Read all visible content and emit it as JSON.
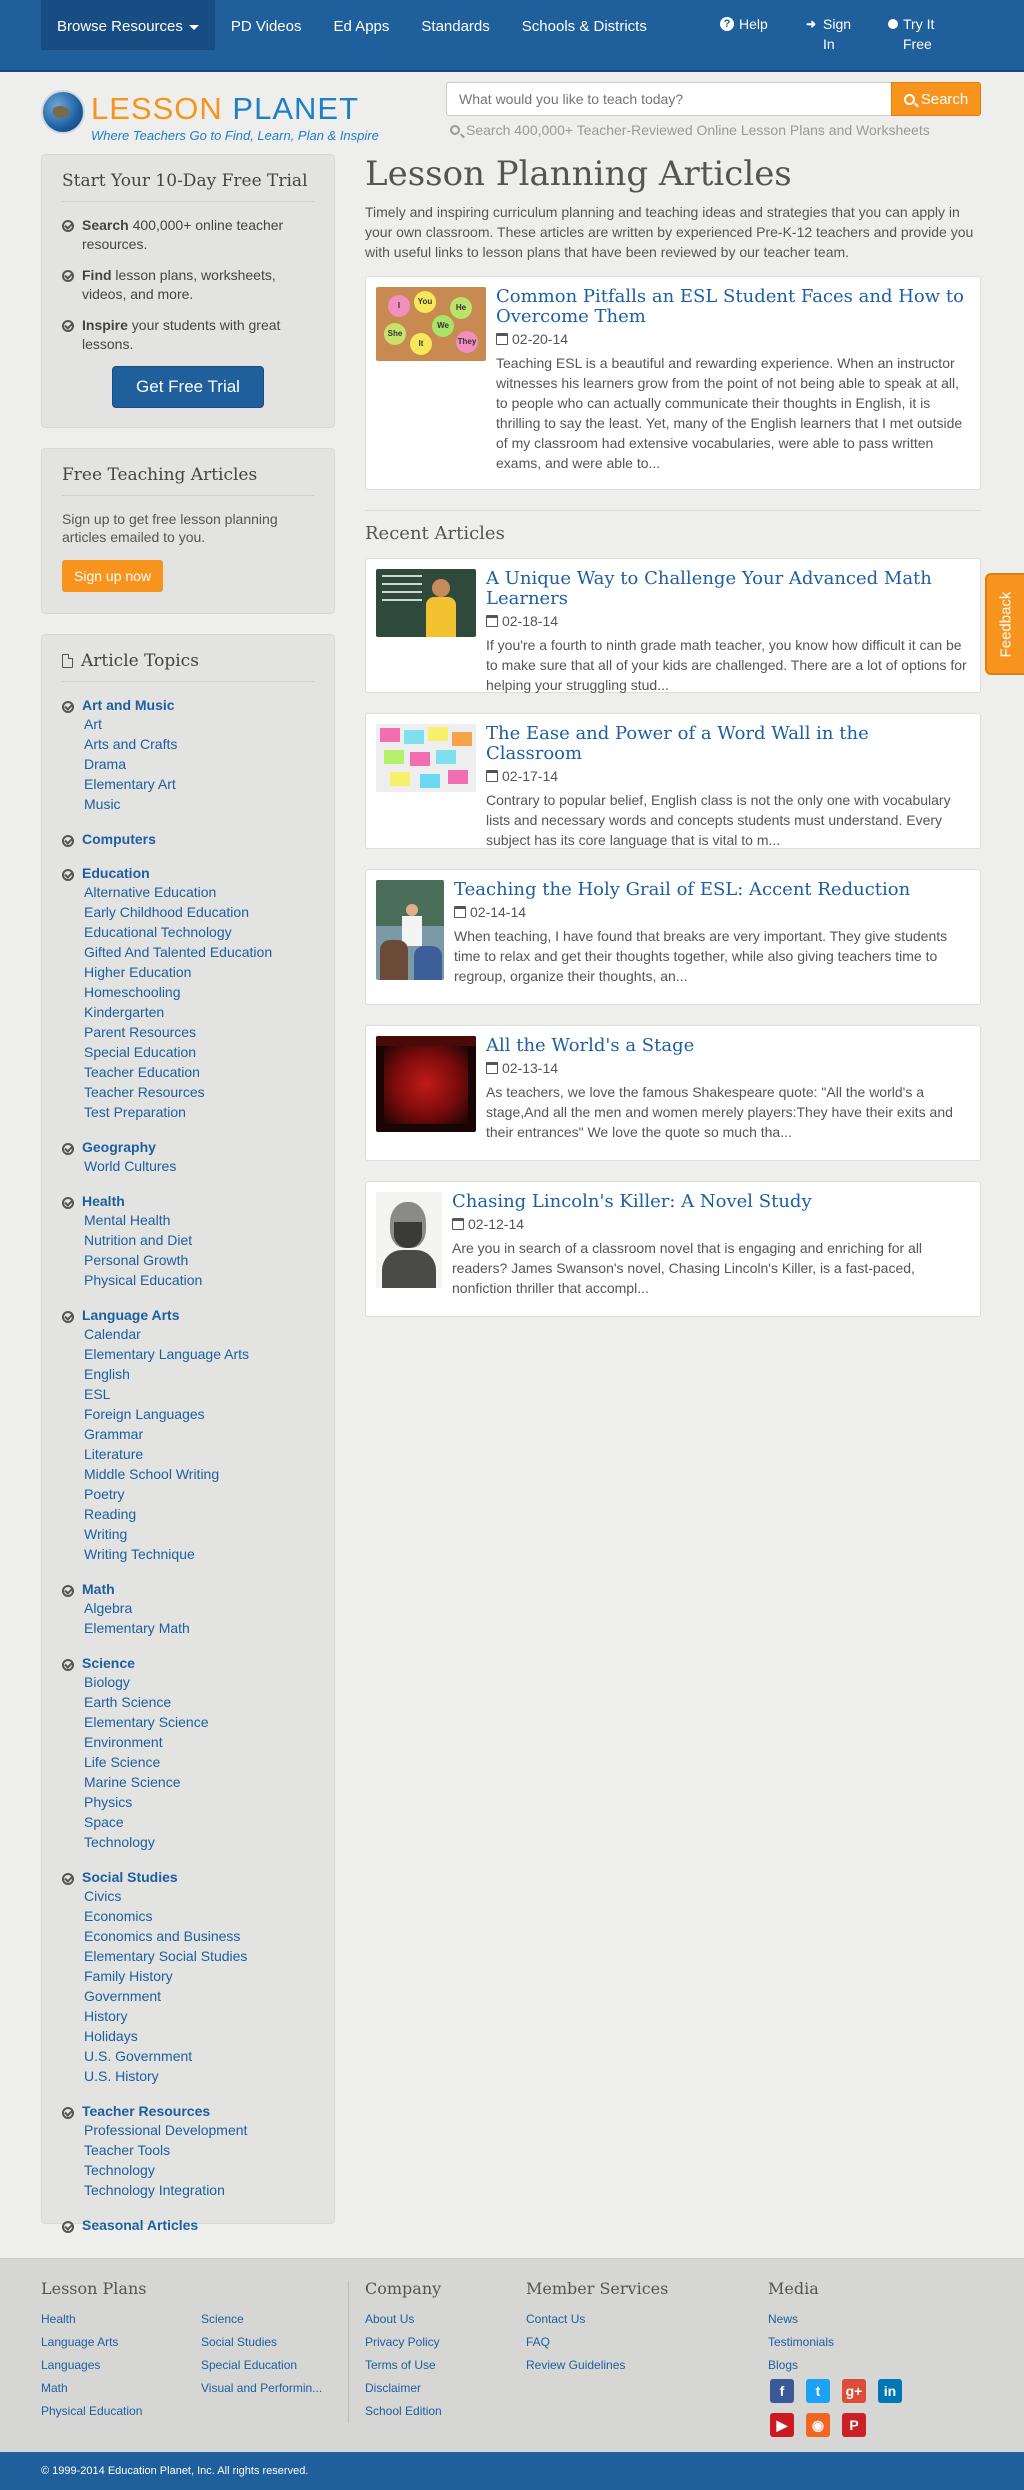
{
  "topnav": {
    "items": [
      "Browse Resources",
      "PD Videos",
      "Ed Apps",
      "Standards",
      "Schools & Districts"
    ],
    "links": [
      "Help",
      "Sign In",
      "Try It Free"
    ]
  },
  "brand": {
    "logo_lesson": "LESSON",
    "logo_planet": "PLANET",
    "tagline": "Where Teachers Go to Find, Learn, Plan & Inspire"
  },
  "search": {
    "placeholder": "What would you like to teach today?",
    "button": "Search",
    "subtext": "Search 400,000+ Teacher-Reviewed Online Lesson Plans and Worksheets"
  },
  "trial_box": {
    "title": "Start Your 10-Day Free Trial",
    "items": [
      {
        "bold": "Search",
        "text": " 400,000+ online teacher resources."
      },
      {
        "bold": "Find",
        "text": " lesson plans, worksheets, videos, and more."
      },
      {
        "bold": "Inspire",
        "text": " your students with great lessons."
      }
    ],
    "button": "Get Free Trial"
  },
  "free_articles": {
    "title": "Free Teaching Articles",
    "desc": "Sign up to get free lesson planning articles emailed to you.",
    "button": "Sign up now"
  },
  "topics": {
    "title": "Article Topics",
    "groups": [
      {
        "name": "Art and Music",
        "items": [
          "Art",
          "Arts and Crafts",
          "Drama",
          "Elementary Art",
          "Music"
        ]
      },
      {
        "name": "Computers",
        "items": []
      },
      {
        "name": "Education",
        "items": [
          "Alternative Education",
          "Early Childhood Education",
          "Educational Technology",
          "Gifted And Talented Education",
          "Higher Education",
          "Homeschooling",
          "Kindergarten",
          "Parent Resources",
          "Special Education",
          "Teacher Education",
          "Teacher Resources",
          "Test Preparation"
        ]
      },
      {
        "name": "Geography",
        "items": [
          "World Cultures"
        ]
      },
      {
        "name": "Health",
        "items": [
          "Mental Health",
          "Nutrition and Diet",
          "Personal Growth",
          "Physical Education"
        ]
      },
      {
        "name": "Language Arts",
        "items": [
          "Calendar",
          "Elementary Language Arts",
          "English",
          "ESL",
          "Foreign Languages",
          "Grammar",
          "Literature",
          "Middle School Writing",
          "Poetry",
          "Reading",
          "Writing",
          "Writing Technique"
        ]
      },
      {
        "name": "Math",
        "items": [
          "Algebra",
          "Elementary Math"
        ]
      },
      {
        "name": "Science",
        "items": [
          "Biology",
          "Earth Science",
          "Elementary Science",
          "Environment",
          "Life Science",
          "Marine Science",
          "Physics",
          "Space",
          "Technology"
        ]
      },
      {
        "name": "Social Studies",
        "items": [
          "Civics",
          "Economics",
          "Economics and Business",
          "Elementary Social Studies",
          "Family History",
          "Government",
          "History",
          "Holidays",
          "U.S. Government",
          "U.S. History"
        ]
      },
      {
        "name": "Teacher Resources",
        "items": [
          "Professional Development",
          "Teacher Tools",
          "Technology",
          "Technology Integration"
        ]
      },
      {
        "name": "Seasonal Articles",
        "items": []
      }
    ]
  },
  "main": {
    "title": "Lesson Planning Articles",
    "intro": "Timely and inspiring curriculum planning and teaching ideas and strategies that you can apply in your own classroom. These articles are written by experienced Pre-K-12 teachers and provide you with useful links to lesson plans that have been reviewed by our teacher team.",
    "featured": {
      "title": "Common Pitfalls an ESL Student Faces and How to Overcome Them",
      "date": "02-20-14",
      "excerpt": "Teaching ESL is a beautiful and rewarding experience. When an instructor witnesses his learners grow from the point of not being able to speak at all, to people who can actually communicate their thoughts in English, it is thrilling to say the least. Yet, many of the English learners that I met outside of my classroom had extensive vocabularies, were able to pass written exams, and were able to...",
      "thumb_words": [
        "I",
        "You",
        "He",
        "She",
        "It",
        "We",
        "They"
      ]
    },
    "recent_title": "Recent Articles",
    "recent": [
      {
        "title": "A Unique Way to Challenge Your Advanced Math Learners",
        "date": "02-18-14",
        "excerpt": "If you're a fourth to ninth grade math teacher, you know how difficult it can be to make sure that all of your kids are challenged. There are a lot of options for helping your struggling stud..."
      },
      {
        "title": "The Ease and Power of a Word Wall in the Classroom",
        "date": "02-17-14",
        "excerpt": "Contrary to popular belief, English class is not the only one with vocabulary lists and necessary words and concepts students must understand. Every subject has its core language that is vital to m..."
      },
      {
        "title": "Teaching the Holy Grail of ESL: Accent Reduction",
        "date": "02-14-14",
        "excerpt": "When teaching, I have found that breaks are very important. They give students time to relax and get their thoughts together, while also giving teachers time to regroup, organize their thoughts, an..."
      },
      {
        "title": "All the World's a Stage",
        "date": "02-13-14",
        "excerpt": "As teachers, we love the famous Shakespeare quote:  \"All the world's a stage,And all the men and women merely players:They have their exits and their entrances\" We love the quote so much tha..."
      },
      {
        "title": "Chasing Lincoln's Killer: A Novel Study",
        "date": "02-12-14",
        "excerpt": "Are you in search of a classroom novel that is engaging and enriching for all readers? James Swanson's novel, Chasing Lincoln's Killer, is a fast-paced, nonfiction thriller that accompl..."
      }
    ]
  },
  "feedback": "Feedback",
  "footer": {
    "lesson_plans": {
      "title": "Lesson Plans",
      "col1": [
        "Health",
        "Language Arts",
        "Languages",
        "Math",
        "Physical Education"
      ],
      "col2": [
        "Science",
        "Social Studies",
        "Special Education",
        "Visual and Performin..."
      ]
    },
    "company": {
      "title": "Company",
      "items": [
        "About Us",
        "Privacy Policy",
        "Terms of Use",
        "Disclaimer",
        "School Edition"
      ]
    },
    "member": {
      "title": "Member Services",
      "items": [
        "Contact Us",
        "FAQ",
        "Review Guidelines"
      ]
    },
    "media": {
      "title": "Media",
      "items": [
        "News",
        "Testimonials",
        "Blogs"
      ]
    },
    "social": [
      {
        "name": "facebook-icon",
        "glyph": "f",
        "color": "#3b5998"
      },
      {
        "name": "twitter-icon",
        "glyph": "t",
        "color": "#1da1f2"
      },
      {
        "name": "google-plus-icon",
        "glyph": "g+",
        "color": "#dd4b39"
      },
      {
        "name": "linkedin-icon",
        "glyph": "in",
        "color": "#0077b5"
      },
      {
        "name": "youtube-icon",
        "glyph": "▶",
        "color": "#cc181e"
      },
      {
        "name": "rss-icon",
        "glyph": "◉",
        "color": "#f26522"
      },
      {
        "name": "pinterest-icon",
        "glyph": "P",
        "color": "#cb2027"
      }
    ],
    "copyright": "© 1999-2014 Education Planet, Inc. All rights reserved."
  },
  "colors": {
    "brand_blue": "#1f5f9c",
    "accent_orange": "#f7941d",
    "link": "#1d5fa0"
  }
}
